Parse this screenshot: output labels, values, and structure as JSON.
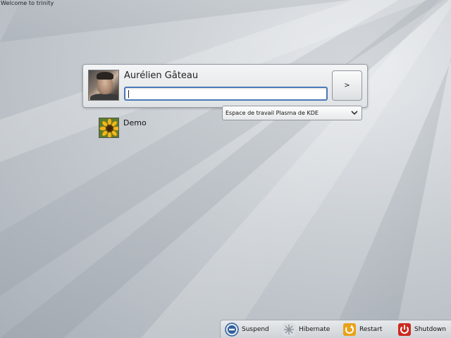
{
  "screen": {
    "welcome_text": "Welcome to trinity"
  },
  "login": {
    "user_name": "Aurélien Gâteau",
    "password_value": "",
    "login_button_label": ">"
  },
  "session": {
    "selected": "Espace de travail Plasma de KDE"
  },
  "users": [
    {
      "name": "Demo"
    }
  ],
  "power": {
    "suspend_label": "Suspend",
    "hibernate_label": "Hibernate",
    "restart_label": "Restart",
    "shutdown_label": "Shutdown"
  },
  "colors": {
    "focus_border": "#4b79b8",
    "shutdown_red": "#cc2a1e",
    "restart_orange": "#e9a21a",
    "suspend_blue": "#2f5f9a"
  }
}
